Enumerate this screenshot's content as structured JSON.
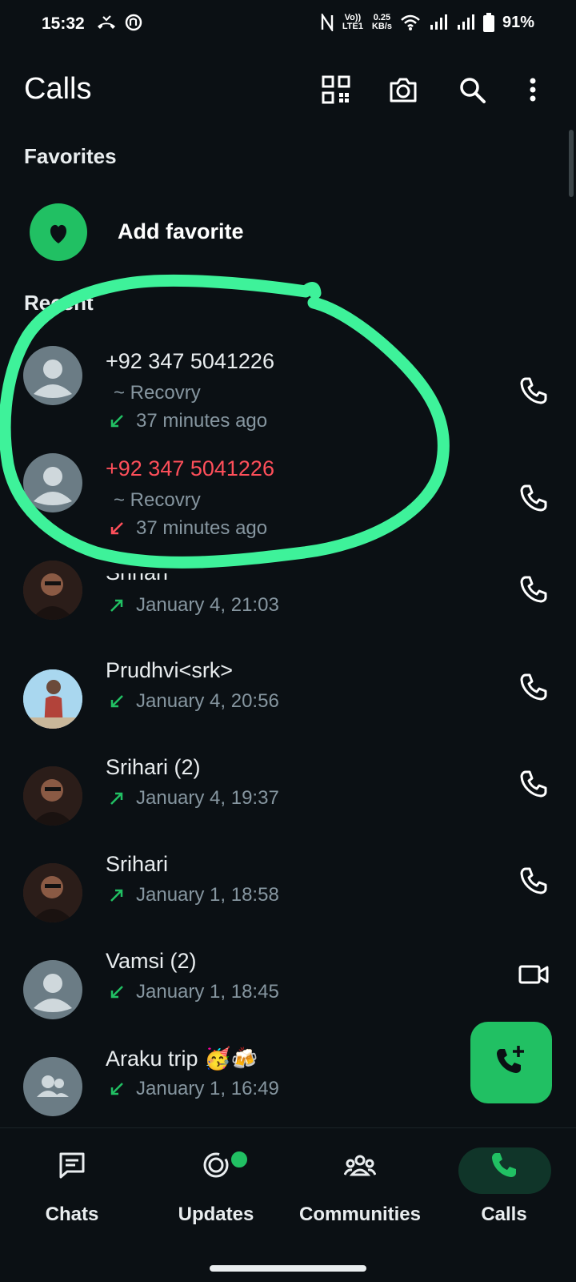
{
  "status_bar": {
    "time": "15:32",
    "volte": "Vo)) LTE1",
    "speed_value": "0.25",
    "speed_unit": "KB/s",
    "battery": "91%"
  },
  "app_bar": {
    "title": "Calls"
  },
  "favorites": {
    "section_title": "Favorites",
    "add_label": "Add favorite"
  },
  "recent": {
    "section_title": "Recent"
  },
  "calls": [
    {
      "name": "+92 347 5041226",
      "subtitle": "~ Recovry",
      "direction": "incoming",
      "time": "37 minutes ago",
      "missed": false,
      "action": "voice-call"
    },
    {
      "name": "+92 347 5041226",
      "subtitle": "~ Recovry",
      "direction": "missed",
      "time": "37 minutes ago",
      "missed": true,
      "action": "voice-call"
    },
    {
      "name": "Srihari",
      "direction": "outgoing",
      "time": "January 4, 21:03",
      "missed": false,
      "action": "voice-call"
    },
    {
      "name": "Prudhvi<srk>",
      "direction": "incoming",
      "time": "January 4, 20:56",
      "missed": false,
      "action": "voice-call"
    },
    {
      "name": "Srihari (2)",
      "direction": "outgoing",
      "time": "January 4, 19:37",
      "missed": false,
      "action": "voice-call"
    },
    {
      "name": "Srihari",
      "direction": "outgoing",
      "time": "January 1, 18:58",
      "missed": false,
      "action": "voice-call"
    },
    {
      "name": "Vamsi (2)",
      "direction": "incoming",
      "time": "January 1, 18:45",
      "missed": false,
      "action": "video-call"
    },
    {
      "name": "Araku trip 🥳🍻",
      "direction": "incoming",
      "time": "January 1, 16:49",
      "missed": false,
      "action": "none"
    }
  ],
  "bottom_nav": [
    {
      "label": "Chats",
      "icon": "chat-icon"
    },
    {
      "label": "Updates",
      "icon": "updates-icon"
    },
    {
      "label": "Communities",
      "icon": "communities-icon"
    },
    {
      "label": "Calls",
      "icon": "phone-icon",
      "active": true
    }
  ],
  "colors": {
    "accent": "#21c063",
    "missed": "#ff4f5a",
    "background": "#0b1014",
    "annotation": "#3ef29a"
  }
}
